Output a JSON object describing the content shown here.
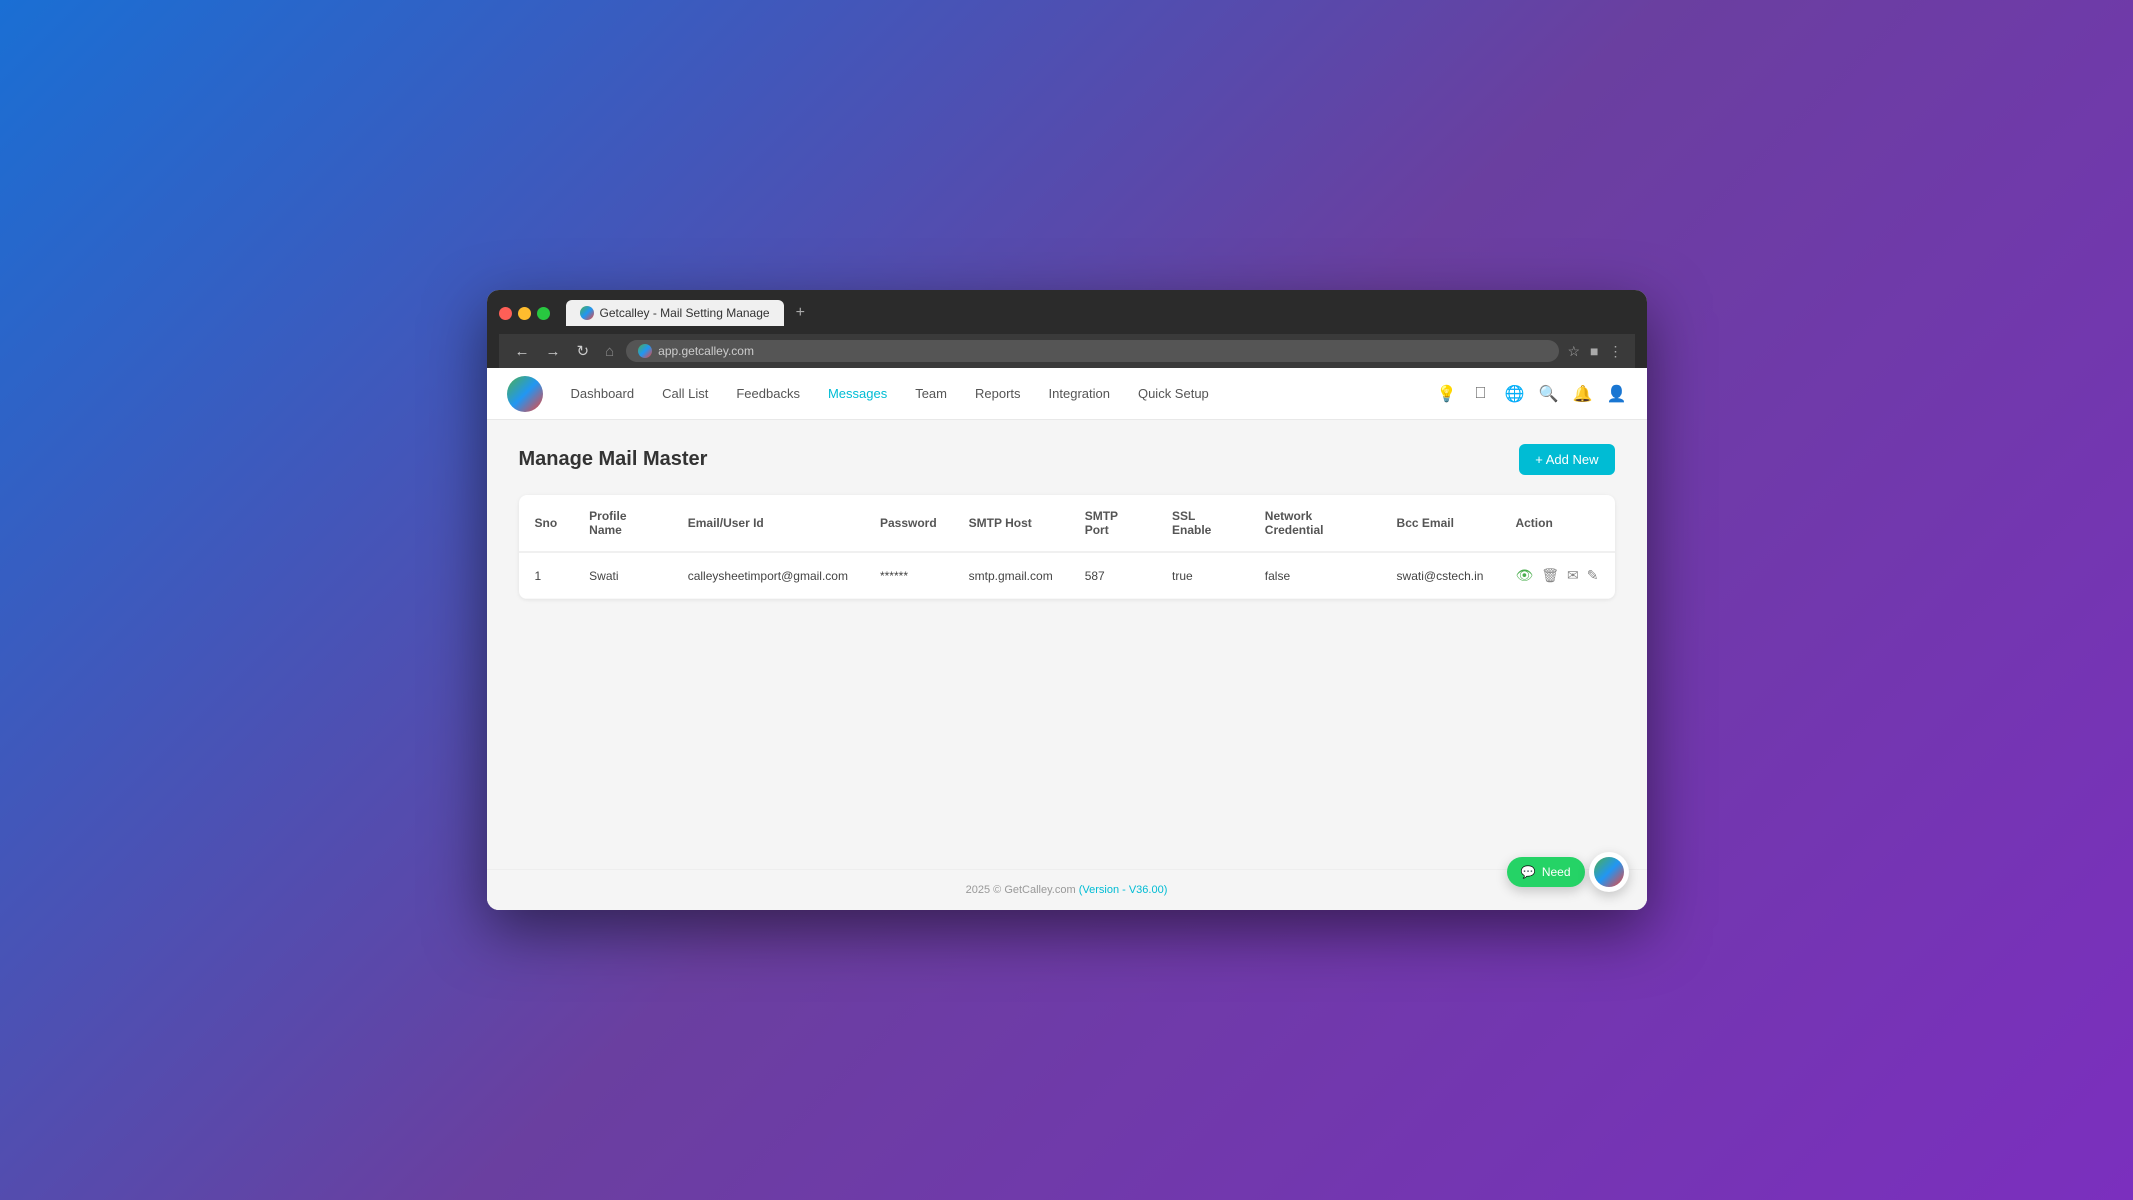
{
  "browser": {
    "tab_title": "Getcalley - Mail Setting Manage",
    "tab_plus": "+",
    "address": "app.getcalley.com",
    "nav_buttons": [
      "←",
      "→",
      "↻",
      "⌂"
    ]
  },
  "nav": {
    "links": [
      {
        "label": "Dashboard",
        "active": false
      },
      {
        "label": "Call List",
        "active": false
      },
      {
        "label": "Feedbacks",
        "active": false
      },
      {
        "label": "Messages",
        "active": true
      },
      {
        "label": "Team",
        "active": false
      },
      {
        "label": "Reports",
        "active": false
      },
      {
        "label": "Integration",
        "active": false
      },
      {
        "label": "Quick Setup",
        "active": false
      }
    ]
  },
  "page": {
    "title": "Manage Mail Master",
    "add_button": "+ Add New"
  },
  "table": {
    "columns": [
      "Sno",
      "Profile Name",
      "Email/User Id",
      "Password",
      "SMTP Host",
      "SMTP Port",
      "SSL Enable",
      "Network Credential",
      "Bcc Email",
      "Action"
    ],
    "rows": [
      {
        "sno": "1",
        "profile_name": "Swati",
        "email": "calleysheetimport@gmail.com",
        "password": "******",
        "smtp_host": "smtp.gmail.com",
        "smtp_port": "587",
        "ssl_enable": "true",
        "network_credential": "false",
        "bcc_email": "swati@cstech.in"
      }
    ]
  },
  "footer": {
    "text": "2025 © GetCalley.com",
    "version_label": "(Version - V36.00)"
  },
  "chat_widget": {
    "whatsapp_label": "Need"
  }
}
